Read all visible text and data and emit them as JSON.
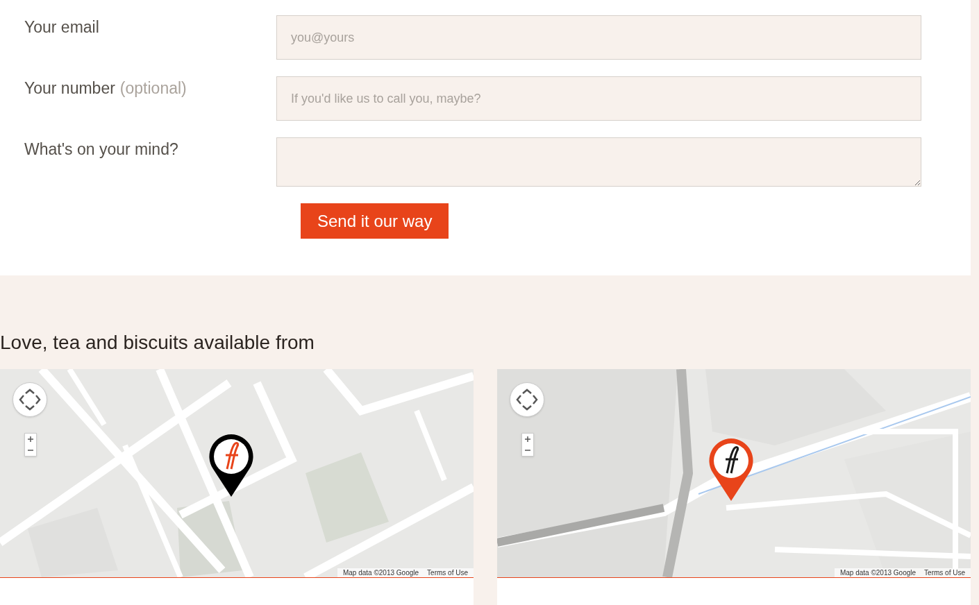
{
  "form": {
    "fields": [
      {
        "kind": "input",
        "label": "Your email",
        "placeholder": "you@yours"
      },
      {
        "kind": "input",
        "label": "Your number",
        "hint": "(optional)",
        "placeholder": "If you'd like us to call you, maybe?"
      },
      {
        "kind": "textarea",
        "label": "What's on your mind?"
      }
    ],
    "submit": "Send it our way"
  },
  "locations": {
    "heading": "Love, tea and biscuits available from",
    "maps": [
      {
        "kind": "dark",
        "attribution": "Map data ©2013 Google",
        "terms": "Terms of Use"
      },
      {
        "kind": "orange",
        "attribution": "Map data ©2013 Google",
        "terms": "Terms of Use"
      }
    ]
  }
}
